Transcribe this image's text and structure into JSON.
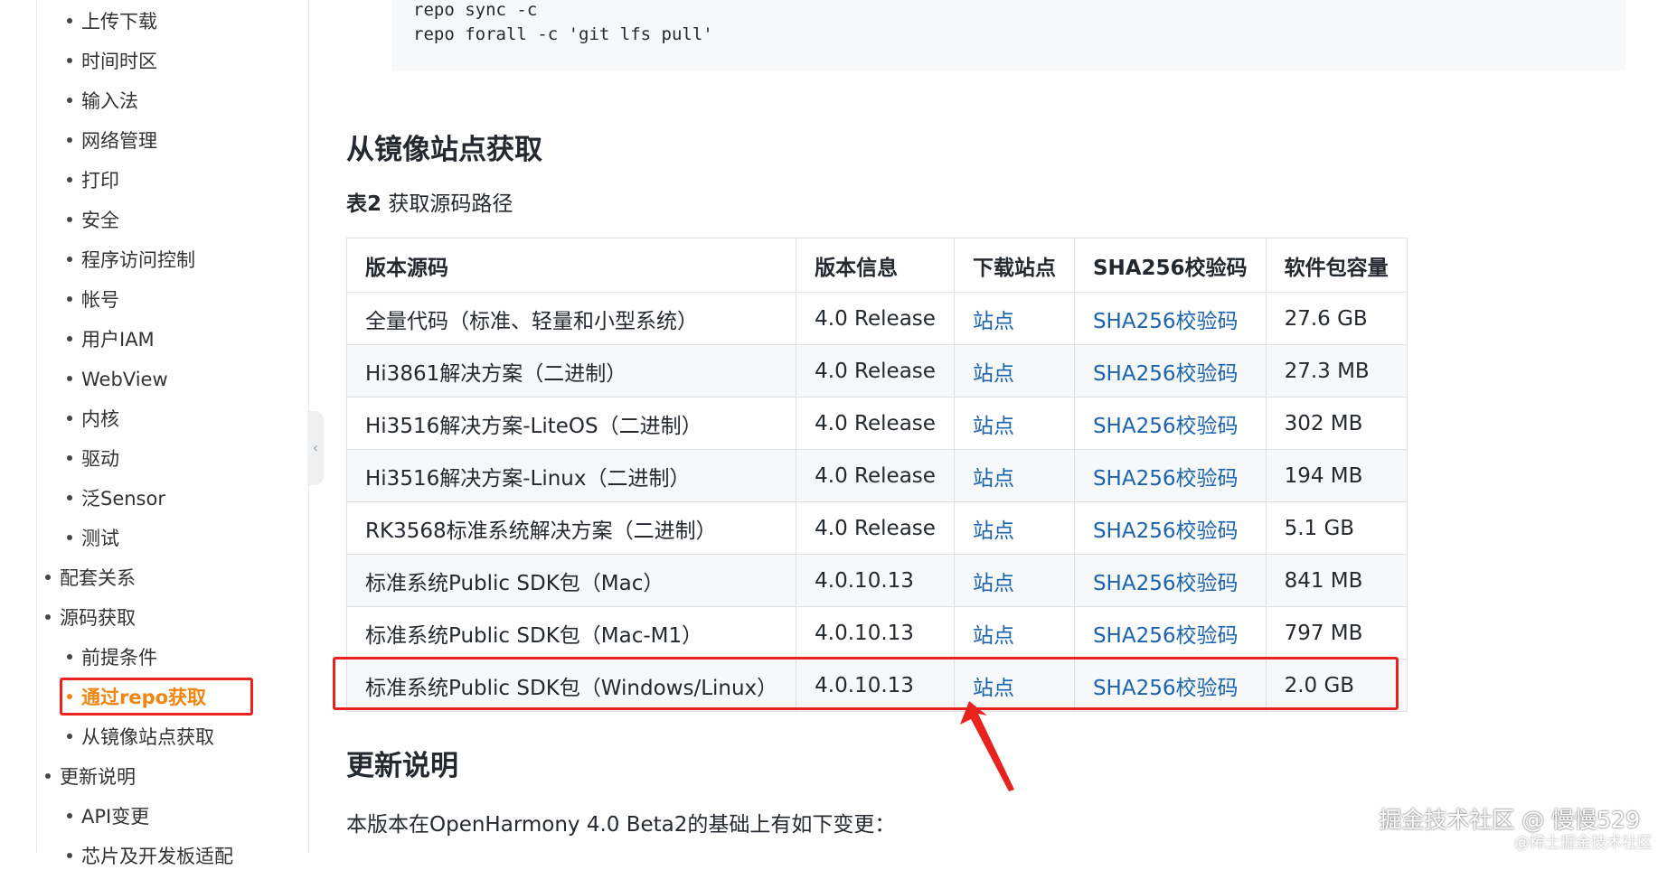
{
  "sidebar": {
    "items": [
      {
        "label": "上传下载"
      },
      {
        "label": "时间时区"
      },
      {
        "label": "输入法"
      },
      {
        "label": "网络管理"
      },
      {
        "label": "打印"
      },
      {
        "label": "安全"
      },
      {
        "label": "程序访问控制"
      },
      {
        "label": "帐号"
      },
      {
        "label": "用户IAM"
      },
      {
        "label": "WebView"
      },
      {
        "label": "内核"
      },
      {
        "label": "驱动"
      },
      {
        "label": "泛Sensor"
      },
      {
        "label": "测试"
      },
      {
        "label": "配套关系"
      },
      {
        "label": "源码获取"
      },
      {
        "label": "前提条件"
      },
      {
        "label": "通过repo获取"
      },
      {
        "label": "从镜像站点获取"
      },
      {
        "label": "更新说明"
      },
      {
        "label": "API变更"
      },
      {
        "label": "芯片及开发板适配"
      }
    ],
    "active_label": "通过repo获取",
    "collapse_icon": "chevron-left-icon"
  },
  "code": {
    "lines": [
      "repo sync -c",
      "repo forall -c 'git lfs pull'"
    ]
  },
  "section": {
    "title": "从镜像站点获取",
    "caption_prefix": "表2",
    "caption_text": " 获取源码路径"
  },
  "table": {
    "headers": [
      "版本源码",
      "版本信息",
      "下载站点",
      "SHA256校验码",
      "软件包容量"
    ],
    "rows": [
      {
        "name": "全量代码（标准、轻量和小型系统）",
        "version": "4.0 Release",
        "site": "站点",
        "sha": "SHA256校验码",
        "size": "27.6 GB"
      },
      {
        "name": "Hi3861解决方案（二进制）",
        "version": "4.0 Release",
        "site": "站点",
        "sha": "SHA256校验码",
        "size": "27.3 MB"
      },
      {
        "name": "Hi3516解决方案-LiteOS（二进制）",
        "version": "4.0 Release",
        "site": "站点",
        "sha": "SHA256校验码",
        "size": "302 MB"
      },
      {
        "name": "Hi3516解决方案-Linux（二进制）",
        "version": "4.0 Release",
        "site": "站点",
        "sha": "SHA256校验码",
        "size": "194 MB"
      },
      {
        "name": "RK3568标准系统解决方案（二进制）",
        "version": "4.0 Release",
        "site": "站点",
        "sha": "SHA256校验码",
        "size": "5.1 GB"
      },
      {
        "name": "标准系统Public SDK包（Mac）",
        "version": "4.0.10.13",
        "site": "站点",
        "sha": "SHA256校验码",
        "size": "841 MB"
      },
      {
        "name": "标准系统Public SDK包（Mac-M1）",
        "version": "4.0.10.13",
        "site": "站点",
        "sha": "SHA256校验码",
        "size": "797 MB"
      },
      {
        "name": "标准系统Public SDK包（Windows/Linux）",
        "version": "4.0.10.13",
        "site": "站点",
        "sha": "SHA256校验码",
        "size": "2.0 GB"
      }
    ],
    "link_color": "#1a63b0"
  },
  "update": {
    "title": "更新说明",
    "text": "本版本在OpenHarmony 4.0 Beta2的基础上有如下变更："
  },
  "annotation": {
    "color": "#e8231e"
  },
  "watermark": {
    "main": "掘金技术社区 @ 慢慢529",
    "sub": "@稀土掘金技术社区"
  }
}
